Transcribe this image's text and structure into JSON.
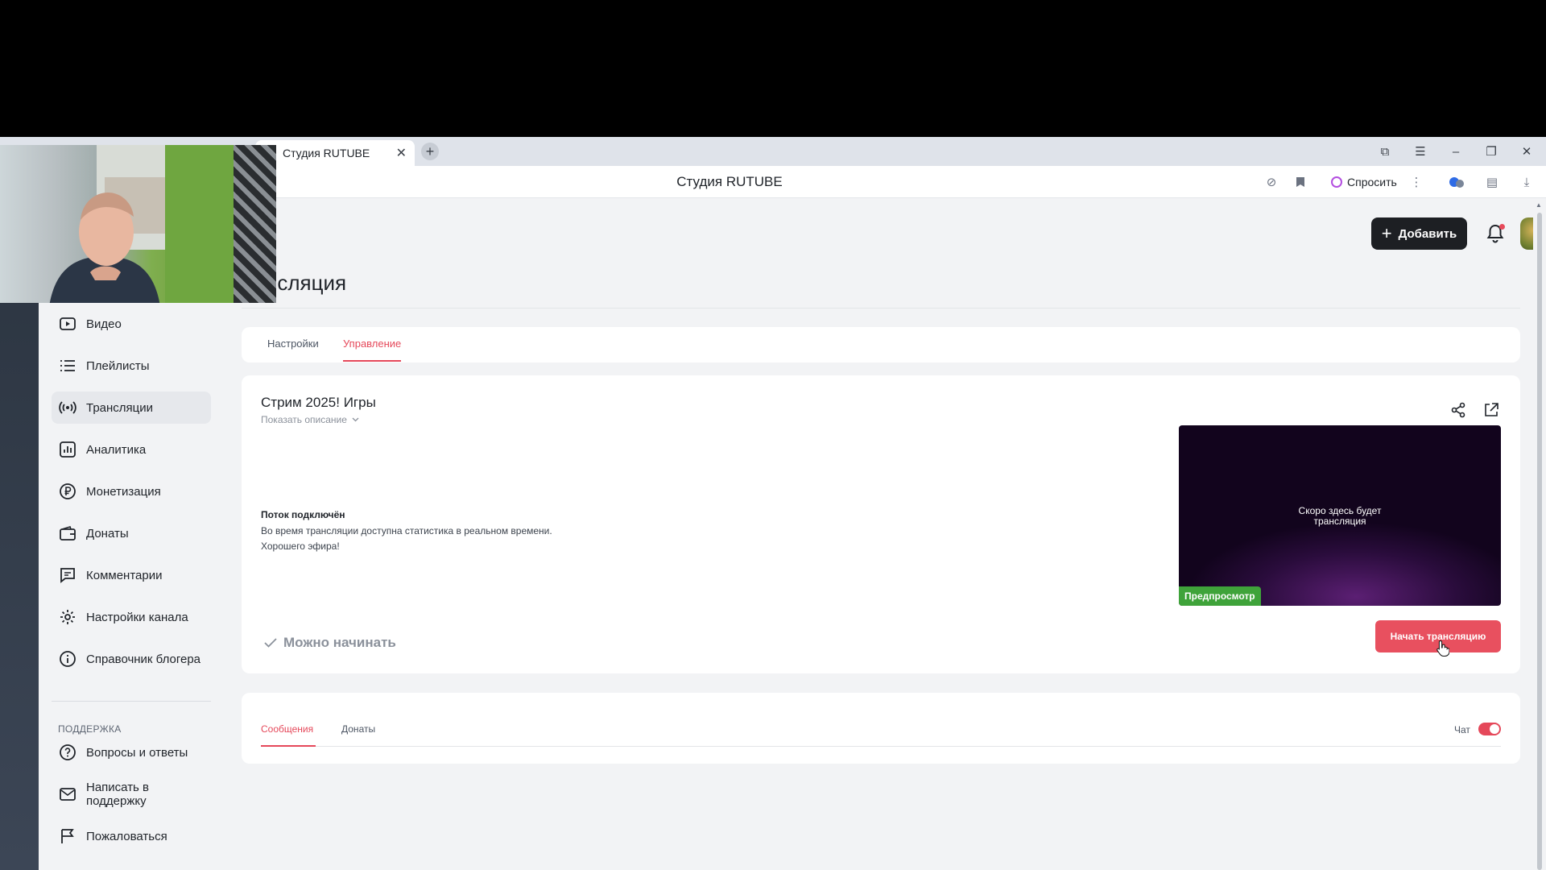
{
  "browser": {
    "tab_title": "Студия RUTUBE",
    "page_title": "Студия RUTUBE",
    "ask_label": "Спросить"
  },
  "header": {
    "add_label": "Добавить",
    "page_heading": "нсляция"
  },
  "sidebar": {
    "items": [
      {
        "label": "Видео",
        "icon": "video-icon"
      },
      {
        "label": "Плейлисты",
        "icon": "list-icon"
      },
      {
        "label": "Трансляции",
        "icon": "broadcast-icon",
        "active": true
      },
      {
        "label": "Аналитика",
        "icon": "chart-icon"
      },
      {
        "label": "Монетизация",
        "icon": "ruble-icon"
      },
      {
        "label": "Донаты",
        "icon": "wallet-icon"
      },
      {
        "label": "Комментарии",
        "icon": "comment-icon"
      },
      {
        "label": "Настройки канала",
        "icon": "gear-icon"
      },
      {
        "label": "Справочник блогера",
        "icon": "info-icon"
      }
    ],
    "support_heading": "ПОДДЕРЖКА",
    "support_items": [
      {
        "label": "Вопросы и ответы",
        "icon": "question-icon"
      },
      {
        "label": "Написать в поддержку",
        "icon": "mail-icon"
      },
      {
        "label": "Пожаловаться",
        "icon": "flag-icon"
      }
    ]
  },
  "tabs": {
    "settings": "Настройки",
    "management": "Управление"
  },
  "stream": {
    "title": "Стрим 2025! Игры",
    "show_description": "Показать описание",
    "status_heading": "Поток подключён",
    "status_line1": "Во время трансляции доступна статистика в реальном времени.",
    "status_line2": "Хорошего эфира!",
    "ready_label": "Можно начинать",
    "preview_text_line1": "Скоро здесь будет",
    "preview_text_line2": "трансляция",
    "preview_badge": "Предпросмотр",
    "start_button": "Начать трансляцию"
  },
  "chat": {
    "messages_tab": "Сообщения",
    "donations_tab": "Донаты",
    "chat_label": "Чат",
    "chat_enabled": true
  },
  "colors": {
    "accent": "#e5485a",
    "start_button": "#e8505f",
    "preview_badge": "#3fa33a",
    "add_button": "#1d1f23"
  }
}
